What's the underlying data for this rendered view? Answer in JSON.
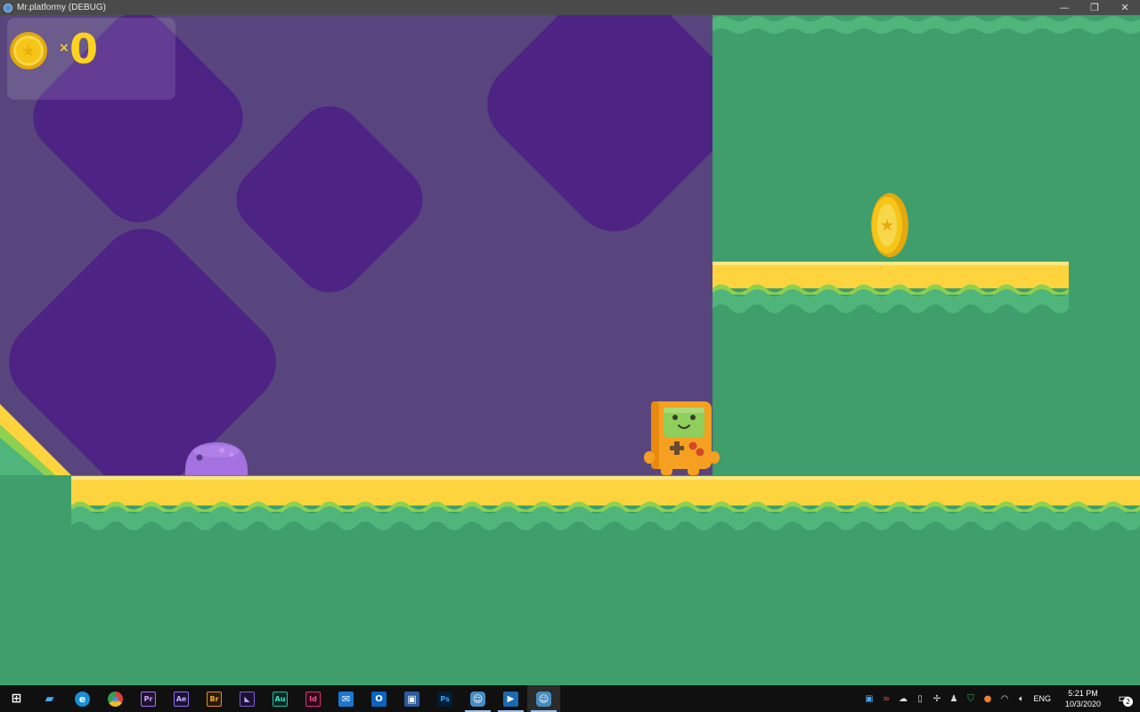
{
  "window": {
    "title": "Mr.platformy (DEBUG)",
    "minimize_glyph": "—",
    "restore_glyph": "❐",
    "close_glyph": "✕"
  },
  "hud": {
    "multiplier": "×",
    "coin_count": "0"
  },
  "colors": {
    "purple_bg": "#58457e",
    "purple_diamond": "#4d2384",
    "ground_green": "#3f9e6b",
    "ground_yellow": "#fdd43e",
    "wave_green": "#4fb57a",
    "coin_gold": "#f5c518"
  },
  "taskbar": {
    "apps": [
      {
        "name": "start-button",
        "glyph": "⊞"
      },
      {
        "name": "file-explorer-app",
        "glyph": "▰"
      },
      {
        "name": "edge-app",
        "glyph": "e"
      },
      {
        "name": "chrome-app",
        "glyph": "◉"
      },
      {
        "name": "premiere-app",
        "glyph": "Pr"
      },
      {
        "name": "after-effects-app",
        "glyph": "Ae"
      },
      {
        "name": "bridge-app",
        "glyph": "Br"
      },
      {
        "name": "visual-studio-app",
        "glyph": "◣"
      },
      {
        "name": "audition-app",
        "glyph": "Au"
      },
      {
        "name": "indesign-app",
        "glyph": "Id"
      },
      {
        "name": "mail-app",
        "glyph": "✉"
      },
      {
        "name": "outlook-app",
        "glyph": "O"
      },
      {
        "name": "calculator-app",
        "glyph": "▣"
      },
      {
        "name": "photoshop-app",
        "glyph": "Ps"
      },
      {
        "name": "godot-app",
        "glyph": "☺"
      },
      {
        "name": "media-app",
        "glyph": "▶"
      },
      {
        "name": "godot-game-app",
        "glyph": "☺"
      }
    ],
    "language": "ENG",
    "time": "5:21 PM",
    "date": "10/3/2020",
    "notification_count": "2"
  }
}
